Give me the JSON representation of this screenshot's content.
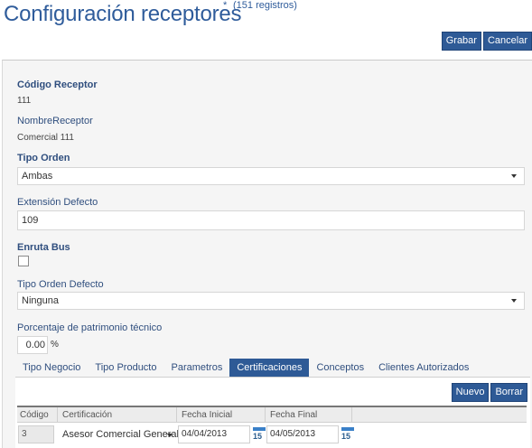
{
  "header": {
    "title": "Configuración receptores",
    "modified_marker": "*",
    "record_count": "(151 registros)",
    "save_label": "Grabar",
    "cancel_label": "Cancelar"
  },
  "form": {
    "codigo_receptor": {
      "label": "Código Receptor",
      "value": "111"
    },
    "nombre_receptor": {
      "label": "NombreReceptor",
      "value": "Comercial 111"
    },
    "tipo_orden": {
      "label": "Tipo Orden",
      "value": "Ambas"
    },
    "extension_defecto": {
      "label": "Extensión Defecto",
      "value": "109"
    },
    "enruta_bus": {
      "label": "Enruta Bus",
      "checked": false
    },
    "tipo_orden_defecto": {
      "label": "Tipo Orden Defecto",
      "value": "Ninguna"
    },
    "porcentaje_patrimonio": {
      "label": "Porcentaje de patrimonio técnico",
      "value": "0.00",
      "unit": "%"
    }
  },
  "tabs": [
    {
      "label": "Tipo Negocio",
      "active": false
    },
    {
      "label": "Tipo Producto",
      "active": false
    },
    {
      "label": "Parametros",
      "active": false
    },
    {
      "label": "Certificaciones",
      "active": true
    },
    {
      "label": "Conceptos",
      "active": false
    },
    {
      "label": "Clientes Autorizados",
      "active": false
    }
  ],
  "grid": {
    "new_label": "Nuevo",
    "delete_label": "Borrar",
    "columns": [
      "Código",
      "Certificación",
      "Fecha Inicial",
      "Fecha Final"
    ],
    "rows": [
      {
        "codigo": "3",
        "certificacion": "Asesor Comercial General",
        "fecha_inicial": "04/04/2013",
        "fecha_final": "04/05/2013"
      }
    ],
    "calendar_day": "15"
  },
  "colors": {
    "accent": "#2e5a96",
    "title": "#2f5c9b",
    "label": "#2f4e7e",
    "panel_bg": "#f5f5f5"
  }
}
